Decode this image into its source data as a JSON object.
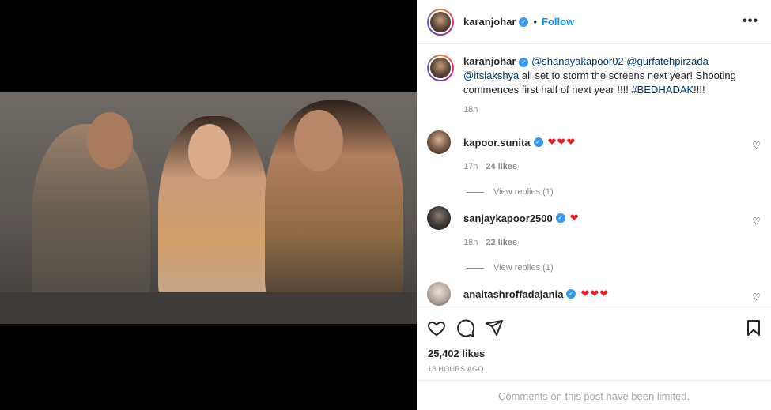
{
  "post": {
    "author": "karanjohar",
    "follow_label": "Follow",
    "separator": "•",
    "more_label": "•••"
  },
  "caption": {
    "author": "karanjohar",
    "mention1": "@shanayakapoor02",
    "mention2": "@gurfatehpirzada",
    "mention3": "@itslakshya",
    "text": "all set to storm the screens next year! Shooting commences first half of next year !!!! ",
    "hashtag": "#BEDHADAK",
    "tail": "!!!!",
    "time": "18h"
  },
  "comments": [
    {
      "user": "kapoor.sunita",
      "text": "❤❤❤",
      "time": "17h",
      "likes": "24 likes",
      "replies": "View replies (1)"
    },
    {
      "user": "sanjaykapoor2500",
      "text": "❤",
      "time": "18h",
      "likes": "22 likes",
      "replies": "View replies (1)"
    },
    {
      "user": "anaitashroffadajania",
      "text": "❤❤❤"
    }
  ],
  "stats": {
    "likes": "25,402 likes",
    "posted": "18 HOURS AGO"
  },
  "footer": {
    "limited": "Comments on this post have been limited."
  },
  "icons": {
    "verified": "verified-badge-icon",
    "like": "heart-icon",
    "comment": "comment-icon",
    "share": "paper-plane-icon",
    "save": "bookmark-icon"
  },
  "colors": {
    "accent": "#0095f6",
    "verified": "#3897f0",
    "heart": "#ed1c24",
    "muted": "#8e8e8e"
  }
}
